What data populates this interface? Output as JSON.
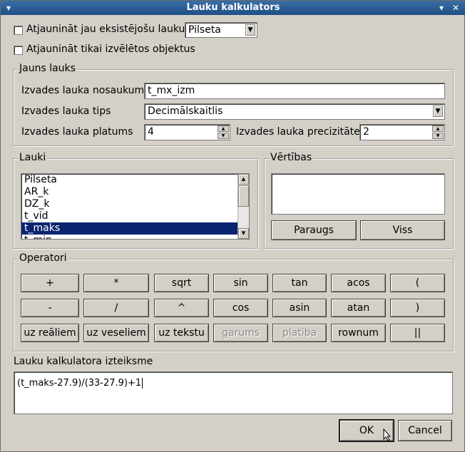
{
  "window": {
    "title": "Lauku kalkulators"
  },
  "update_existing": {
    "label": "Atjaunināt jau eksistējošu lauku",
    "checked": false,
    "field_value": "Pilseta"
  },
  "update_selected": {
    "label": "Atjaunināt tikai izvēlētos objektus",
    "checked": false
  },
  "new_field": {
    "group_title": "Jauns lauks",
    "name_label": "Izvades lauka nosaukums",
    "name_value": "t_mx_izm",
    "type_label": "Izvades lauka tips",
    "type_value": "Decimālskaitlis",
    "width_label": "Izvades lauka platums",
    "width_value": "4",
    "precision_label": "Izvades lauka precizitāte",
    "precision_value": "2"
  },
  "fields": {
    "group_title": "Lauki",
    "items": [
      "Pilseta",
      "AR_k",
      "DZ_k",
      "t_vid",
      "t_maks",
      "t_min"
    ],
    "selected_index": 4
  },
  "values": {
    "group_title": "Vērtības",
    "sample_label": "Paraugs",
    "all_label": "Viss"
  },
  "operators": {
    "group_title": "Operatori",
    "row1": [
      "+",
      "*",
      "sqrt",
      "sin",
      "tan",
      "acos",
      "("
    ],
    "row2": [
      "-",
      "/",
      "^",
      "cos",
      "asin",
      "atan",
      ")"
    ],
    "row3": [
      "uz reāliem",
      "uz veseliem",
      "uz tekstu",
      "garums",
      "platība",
      "rownum",
      "||"
    ],
    "disabled": [
      "garums",
      "platība"
    ]
  },
  "expression": {
    "label": "Lauku kalkulatora izteiksme",
    "value": "(t_maks-27.9)/(33-27.9)+1"
  },
  "buttons": {
    "ok": "OK",
    "cancel": "Cancel"
  }
}
